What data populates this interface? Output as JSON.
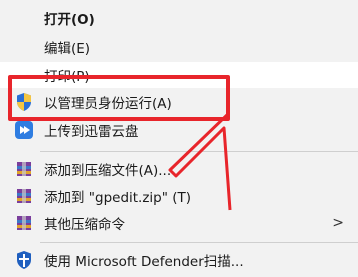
{
  "menu": {
    "open_label": "打开(O)",
    "edit_label": "编辑(E)",
    "print_label": "打印(P)",
    "run_as_admin_label": "以管理员身份运行(A)",
    "upload_xunlei_label": "上传到迅雷云盘",
    "add_to_archive_label": "添加到压缩文件(A)...",
    "add_to_zip_label": "添加到 \"gpedit.zip\" (T)",
    "other_compress_label": "其他压缩命令",
    "defender_scan_label": "使用 Microsoft Defender扫描...",
    "submenu_arrow": ">"
  },
  "colors": {
    "highlight_border": "#e8252b",
    "menu_background": "#f2f2f2"
  },
  "icons": [
    "uac-shield-icon",
    "xunlei-cloud-icon",
    "winrar-archive-icon",
    "defender-shield-icon"
  ]
}
